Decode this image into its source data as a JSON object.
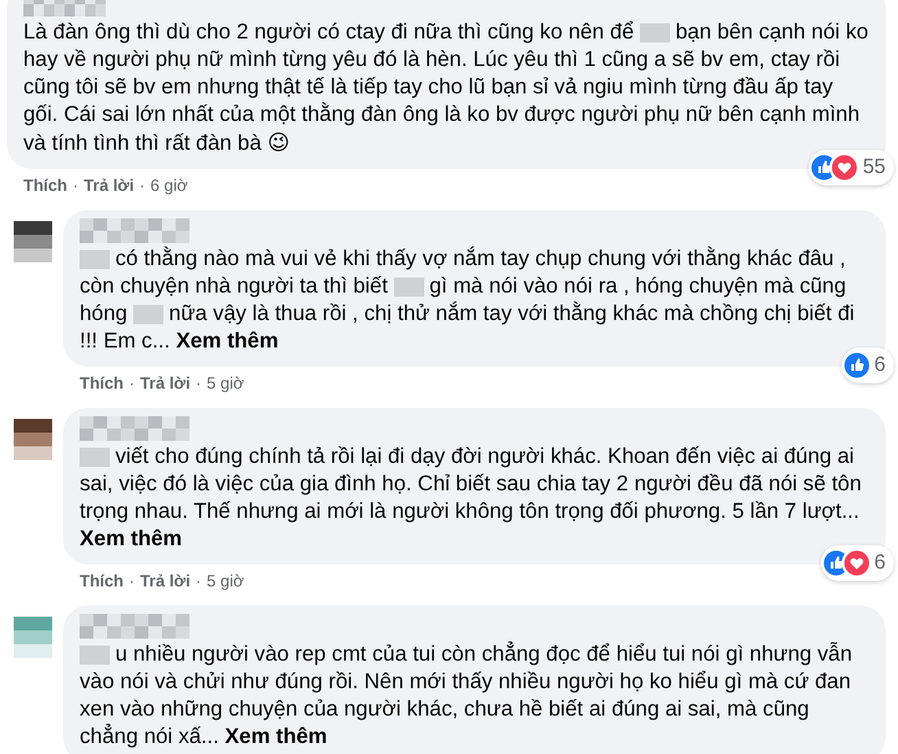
{
  "comments": [
    {
      "author": {
        "kind": "blurred"
      },
      "segments": [
        {
          "kind": "text",
          "text": "Là đàn ông thì dù cho 2 người có ctay đi nữa thì cũng ko nên để"
        },
        {
          "kind": "blur"
        },
        {
          "kind": "text",
          "text": "bạn bên cạnh nói ko hay về người phụ nữ mình từng yêu đó là hèn. Lúc yêu thì 1 cũng a sẽ bv em, ctay rồi cũng tôi sẽ bv em nhưng thật tế là tiếp tay cho lũ bạn sỉ vả ngiu mình từng đầu ấp tay gối. Cái sai lớn nhất của một thằng đàn ông là ko bv được người phụ nữ bên cạnh mình và tính tình thì rất đàn bà"
        },
        {
          "kind": "emoji",
          "text": "😉"
        }
      ],
      "reactions": [
        {
          "kind": "like"
        },
        {
          "kind": "love"
        }
      ],
      "reaction_count": "55",
      "actions": [
        {
          "kind": "link",
          "text": "Thích"
        },
        {
          "kind": "sep",
          "text": "·"
        },
        {
          "kind": "link",
          "text": "Trả lời"
        },
        {
          "kind": "sep",
          "text": "·"
        },
        {
          "kind": "time",
          "text": "6 giờ"
        }
      ]
    },
    {
      "avatar": {
        "kind": "picture"
      },
      "author": {
        "kind": "blurred"
      },
      "segments": [
        {
          "kind": "blur"
        },
        {
          "kind": "text",
          "text": "có thằng nào mà vui vẻ khi thấy vợ nắm tay chụp chung với thằng khác đâu , còn chuyện nhà người ta thì biết"
        },
        {
          "kind": "blur"
        },
        {
          "kind": "text",
          "text": "gì mà nói vào nói ra , hóng chuyện mà cũng hóng"
        },
        {
          "kind": "blur"
        },
        {
          "kind": "text",
          "text": "nữa vậy là thua rồi , chị thử nắm tay với thằng khác mà chồng chị biết đi !!! Em c..."
        },
        {
          "kind": "link",
          "text": "Xem thêm"
        }
      ],
      "reactions": [
        {
          "kind": "like"
        }
      ],
      "reaction_count": "6",
      "actions": [
        {
          "kind": "link",
          "text": "Thích"
        },
        {
          "kind": "sep",
          "text": "·"
        },
        {
          "kind": "link",
          "text": "Trả lời"
        },
        {
          "kind": "sep",
          "text": "·"
        },
        {
          "kind": "time",
          "text": "5 giờ"
        }
      ]
    },
    {
      "avatar": {
        "kind": "picture"
      },
      "author": {
        "kind": "blurred"
      },
      "segments": [
        {
          "kind": "blur"
        },
        {
          "kind": "text",
          "text": "viết cho đúng chính tả rồi lại đi dạy đời người khác. Khoan đến việc ai đúng ai sai, việc đó là việc của gia đình họ. Chỉ biết sau chia tay 2 người đều đã nói sẽ tôn trọng nhau. Thế nhưng ai mới là người không tôn trọng đối phương. 5 lần 7 lượt..."
        },
        {
          "kind": "link",
          "text": "Xem thêm"
        }
      ],
      "reactions": [
        {
          "kind": "like"
        },
        {
          "kind": "love"
        }
      ],
      "reaction_count": "6",
      "actions": [
        {
          "kind": "link",
          "text": "Thích"
        },
        {
          "kind": "sep",
          "text": "·"
        },
        {
          "kind": "link",
          "text": "Trả lời"
        },
        {
          "kind": "sep",
          "text": "·"
        },
        {
          "kind": "time",
          "text": "5 giờ"
        }
      ]
    },
    {
      "avatar": {
        "kind": "picture"
      },
      "author": {
        "kind": "blurred"
      },
      "segments": [
        {
          "kind": "blur"
        },
        {
          "kind": "text",
          "text": "u nhiều người vào rep cmt của tui còn chẳng đọc để hiểu tui nói gì nhưng vẫn vào nói và chửi như đúng rồi. Nên mới thấy nhiều người họ ko hiểu gì mà cứ đan xen vào những chuyện của người khác, chưa hề biết ai đúng ai sai, mà cũng chẳng nói xấ..."
        },
        {
          "kind": "link",
          "text": "Xem thêm"
        }
      ]
    }
  ]
}
